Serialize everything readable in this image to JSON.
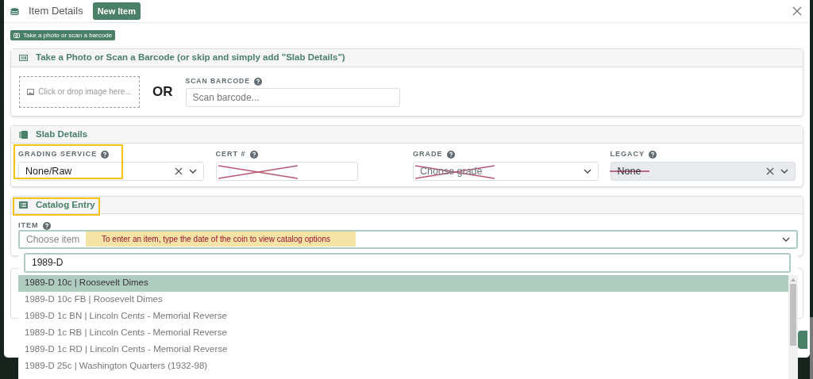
{
  "dialog": {
    "title": "Item Details",
    "badge": "New Item"
  },
  "photo_tag": "Take a photo or scan a barcode",
  "photo_section": {
    "title": "Take a Photo or Scan a Barcode (or skip and simply add \"Slab Details\")",
    "dropzone": "Click or drop image here...",
    "or": "OR",
    "barcode_label": "SCAN BARCODE",
    "barcode_placeholder": "Scan barcode..."
  },
  "slab_section": {
    "title": "Slab Details",
    "fields": [
      {
        "label": "GRADING SERVICE",
        "kind": "select",
        "value": "None/Raw",
        "clearable": true,
        "highlighted": true
      },
      {
        "label": "CERT #",
        "kind": "text",
        "crossed": true
      },
      {
        "label": "GRADE",
        "kind": "select",
        "placeholder": "Choose grade",
        "crossed": true
      },
      {
        "label": "LEGACY",
        "kind": "select",
        "value": "None",
        "clearable": true,
        "disabled": true,
        "struck": true
      }
    ]
  },
  "catalog_section": {
    "title": "Catalog Entry",
    "highlighted": true,
    "item_label": "ITEM",
    "placeholder": "Choose item",
    "note": "To enter an item, type the date of the coin to view catalog options",
    "search": "1989-D",
    "options": [
      {
        "label": "1989-D 10c | Roosevelt Dimes",
        "selected": true
      },
      {
        "label": "1989-D 10c FB | Roosevelt Dimes",
        "selected": false
      },
      {
        "label": "1989-D 1c BN | Lincoln Cents - Memorial Reverse",
        "selected": false
      },
      {
        "label": "1989-D 1c RB | Lincoln Cents - Memorial Reverse",
        "selected": false
      },
      {
        "label": "1989-D 1c RD | Lincoln Cents - Memorial Reverse",
        "selected": false
      },
      {
        "label": "1989-D 25c | Washington Quarters (1932-98)",
        "selected": false
      }
    ]
  }
}
